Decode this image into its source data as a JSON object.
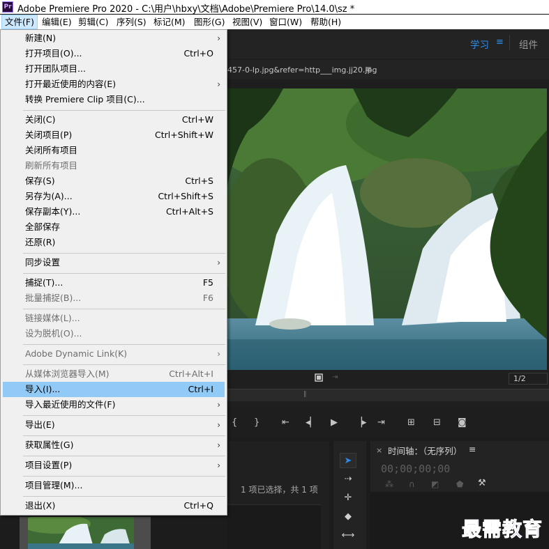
{
  "titlebar": {
    "logo": "Pr",
    "title": "Adobe Premiere Pro 2020 - C:\\用户\\hbxy\\文档\\Adobe\\Premiere Pro\\14.0\\sz *"
  },
  "menubar": [
    "文件(F)",
    "编辑(E)",
    "剪辑(C)",
    "序列(S)",
    "标记(M)",
    "图形(G)",
    "视图(V)",
    "窗口(W)",
    "帮助(H)"
  ],
  "workspace": {
    "learn": "学习",
    "assembly": "组件"
  },
  "program_monitor": {
    "tab_title": "457-0-lp.jpg&refer=http___img.jj20.jpg",
    "fraction": "1/2"
  },
  "project_panel": {
    "status": "1 项已选择，共 1 项"
  },
  "timeline": {
    "close": "×",
    "title": "时间轴：（无序列）",
    "timecode": "00;00;00;00"
  },
  "watermark": "最需教育",
  "file_menu": [
    {
      "label": "新建(N)",
      "shortcut": "",
      "submenu": true,
      "disabled": false
    },
    {
      "label": "打开项目(O)...",
      "shortcut": "Ctrl+O",
      "submenu": false,
      "disabled": false
    },
    {
      "label": "打开团队项目...",
      "shortcut": "",
      "submenu": false,
      "disabled": false
    },
    {
      "label": "打开最近使用的内容(E)",
      "shortcut": "",
      "submenu": true,
      "disabled": false
    },
    {
      "label": "转换 Premiere Clip 项目(C)...",
      "shortcut": "",
      "submenu": false,
      "disabled": false
    },
    {
      "label": "关闭(C)",
      "shortcut": "Ctrl+W",
      "submenu": false,
      "disabled": false
    },
    {
      "label": "关闭项目(P)",
      "shortcut": "Ctrl+Shift+W",
      "submenu": false,
      "disabled": false
    },
    {
      "label": "关闭所有项目",
      "shortcut": "",
      "submenu": false,
      "disabled": false
    },
    {
      "label": "刷新所有项目",
      "shortcut": "",
      "submenu": false,
      "disabled": true
    },
    {
      "label": "保存(S)",
      "shortcut": "Ctrl+S",
      "submenu": false,
      "disabled": false
    },
    {
      "label": "另存为(A)...",
      "shortcut": "Ctrl+Shift+S",
      "submenu": false,
      "disabled": false
    },
    {
      "label": "保存副本(Y)...",
      "shortcut": "Ctrl+Alt+S",
      "submenu": false,
      "disabled": false
    },
    {
      "label": "全部保存",
      "shortcut": "",
      "submenu": false,
      "disabled": false
    },
    {
      "label": "还原(R)",
      "shortcut": "",
      "submenu": false,
      "disabled": false
    },
    {
      "label": "同步设置",
      "shortcut": "",
      "submenu": true,
      "disabled": false
    },
    {
      "label": "捕捉(T)...",
      "shortcut": "F5",
      "submenu": false,
      "disabled": false
    },
    {
      "label": "批量捕捉(B)...",
      "shortcut": "F6",
      "submenu": false,
      "disabled": true
    },
    {
      "label": "链接媒体(L)...",
      "shortcut": "",
      "submenu": false,
      "disabled": true
    },
    {
      "label": "设为脱机(O)...",
      "shortcut": "",
      "submenu": false,
      "disabled": true
    },
    {
      "label": "Adobe Dynamic Link(K)",
      "shortcut": "",
      "submenu": true,
      "disabled": true
    },
    {
      "label": "从媒体浏览器导入(M)",
      "shortcut": "Ctrl+Alt+I",
      "submenu": false,
      "disabled": true
    },
    {
      "label": "导入(I)...",
      "shortcut": "Ctrl+I",
      "submenu": false,
      "disabled": false,
      "highlighted": true
    },
    {
      "label": "导入最近使用的文件(F)",
      "shortcut": "",
      "submenu": true,
      "disabled": false
    },
    {
      "label": "导出(E)",
      "shortcut": "",
      "submenu": true,
      "disabled": false
    },
    {
      "label": "获取属性(G)",
      "shortcut": "",
      "submenu": true,
      "disabled": false
    },
    {
      "label": "项目设置(P)",
      "shortcut": "",
      "submenu": true,
      "disabled": false
    },
    {
      "label": "项目管理(M)...",
      "shortcut": "",
      "submenu": false,
      "disabled": false
    },
    {
      "label": "退出(X)",
      "shortcut": "Ctrl+Q",
      "submenu": false,
      "disabled": false
    }
  ]
}
